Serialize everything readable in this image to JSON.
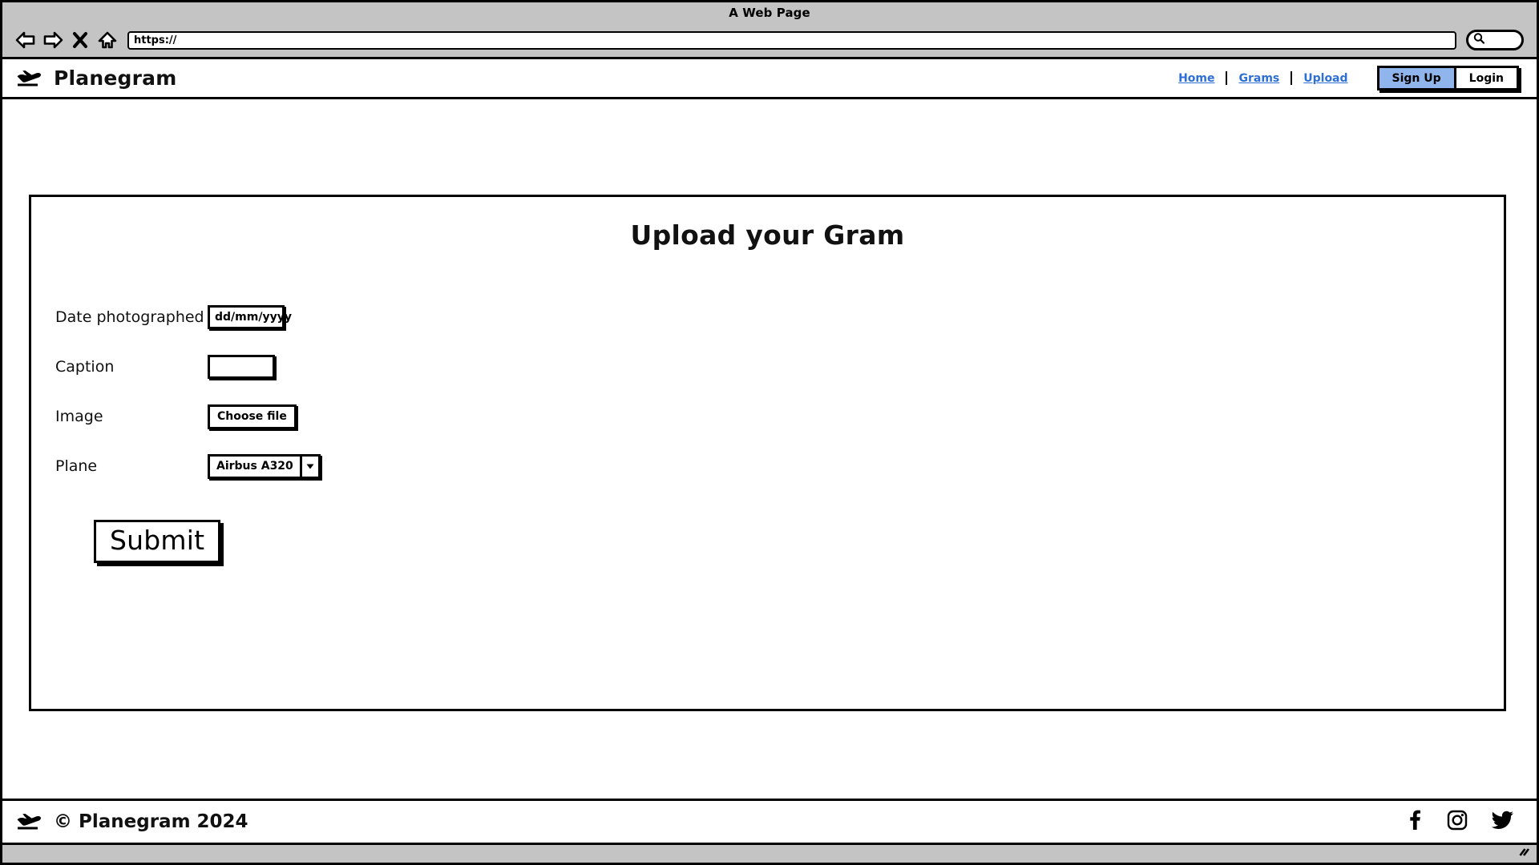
{
  "browser": {
    "title": "A Web Page",
    "url_value": "https://",
    "back_icon": "back-arrow-icon",
    "forward_icon": "forward-arrow-icon",
    "stop_icon": "close-x-icon",
    "home_icon": "home-icon",
    "search_icon": "search-icon"
  },
  "navbar": {
    "brand": "Planegram",
    "brand_logo": "plane-takeoff-icon",
    "links": [
      {
        "label": "Home"
      },
      {
        "label": "Grams"
      },
      {
        "label": "Upload"
      }
    ],
    "signup_label": "Sign Up",
    "login_label": "Login",
    "signup_color": "#90b5ec",
    "link_color": "#2d6fd4"
  },
  "main": {
    "title": "Upload your Gram",
    "fields": [
      {
        "label": "Date photographed",
        "type": "text",
        "value": "dd/mm/yyyy",
        "placeholder": "dd/mm/yyyy"
      },
      {
        "label": "Caption",
        "type": "text",
        "value": "",
        "placeholder": ""
      },
      {
        "label": "Image",
        "type": "file",
        "value": "Choose file"
      },
      {
        "label": "Plane",
        "type": "select",
        "value": "Airbus A320",
        "options": [
          "Airbus A320"
        ]
      }
    ],
    "submit_label": "Submit"
  },
  "footer": {
    "logo": "plane-takeoff-icon",
    "copyright": "© Planegram 2024",
    "socials": [
      {
        "name": "facebook-icon"
      },
      {
        "name": "instagram-icon"
      },
      {
        "name": "twitter-icon"
      }
    ]
  }
}
